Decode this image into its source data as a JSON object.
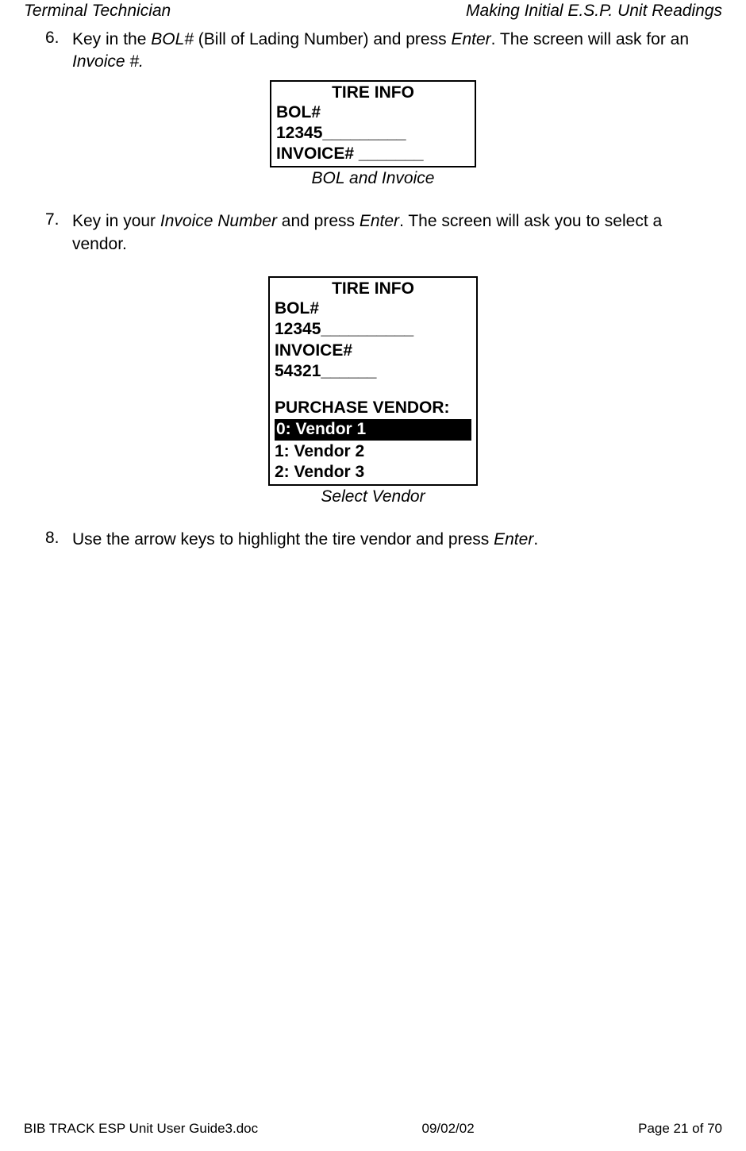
{
  "header": {
    "left": "Terminal Technician",
    "right": "Making Initial E.S.P. Unit Readings"
  },
  "steps": {
    "s6": {
      "num": "6.",
      "pre": "Key in the ",
      "bol": "BOL#",
      "mid1": " (Bill of Lading Number) and press ",
      "enter": "Enter",
      "mid2": ".  The screen will ask for an ",
      "inv": "Invoice #."
    },
    "s7": {
      "num": "7.",
      "pre": "Key in your ",
      "invnum": "Invoice Number",
      "mid1": " and press ",
      "enter": "Enter",
      "post": ".  The screen will ask you to select a vendor."
    },
    "s8": {
      "num": "8.",
      "pre": "Use the arrow keys to highlight the tire vendor and press ",
      "enter": "Enter",
      "post": "."
    }
  },
  "screen1": {
    "title": "TIRE INFO",
    "line1": "BOL#",
    "line2": "12345_________",
    "line3": "INVOICE#  _______",
    "caption": "BOL and Invoice"
  },
  "screen2": {
    "title": "TIRE INFO",
    "line1": "BOL#",
    "line2": "12345__________",
    "line3": "INVOICE#",
    "line4": "54321______",
    "line5": "PURCHASE VENDOR:",
    "vendor0": " 0: Vendor  1",
    "vendor1": "1: Vendor 2",
    "vendor2": "2: Vendor 3",
    "caption": "Select Vendor"
  },
  "footer": {
    "left": "BIB TRACK  ESP Unit User Guide3.doc",
    "center": "09/02/02",
    "right": "Page 21 of 70"
  }
}
